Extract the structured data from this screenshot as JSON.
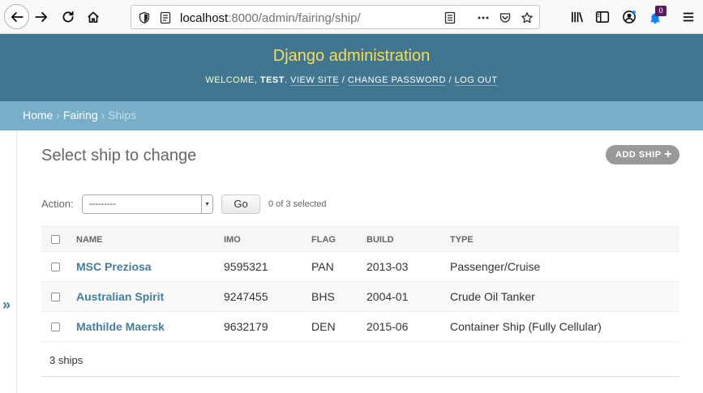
{
  "browser": {
    "url_host": "localhost",
    "url_rest": ":8000/admin/fairing/ship/",
    "notification_count": "0",
    "icons": [
      "back-icon",
      "forward-icon",
      "reload-icon",
      "home-icon",
      "shield-icon",
      "info-icon",
      "reader-icon",
      "more-icon",
      "pocket-icon",
      "bookmark-star-icon",
      "library-icon",
      "sidebar-icon",
      "account-icon",
      "extension-icon",
      "menu-icon"
    ]
  },
  "header": {
    "branding": "Django administration",
    "welcome": "Welcome, ",
    "username": "test",
    "view_site": "View site",
    "change_password": "Change password",
    "log_out": "Log out"
  },
  "breadcrumbs": {
    "home": "Home",
    "app": "Fairing",
    "current": "Ships"
  },
  "sidebar": {
    "toggle": "»"
  },
  "content": {
    "title": "Select ship to change",
    "add_button": "Add ship",
    "action_label": "Action:",
    "action_selected": "---------",
    "go_button": "Go",
    "selection_count": "0 of 3 selected",
    "columns": [
      "Name",
      "IMO",
      "Flag",
      "Build",
      "Type"
    ],
    "rows": [
      {
        "name": "MSC Preziosa",
        "imo": "9595321",
        "flag": "PAN",
        "build": "2013-03",
        "type": "Passenger/Cruise"
      },
      {
        "name": "Australian Spirit",
        "imo": "9247455",
        "flag": "BHS",
        "build": "2004-01",
        "type": "Crude Oil Tanker"
      },
      {
        "name": "Mathilde Maersk",
        "imo": "9632179",
        "flag": "DEN",
        "build": "2015-06",
        "type": "Container Ship (Fully Cellular)"
      }
    ],
    "result_count": "3 ships"
  },
  "colors": {
    "header_bg": "#417690",
    "branding": "#f5dd5d",
    "breadcrumbs_bg": "#79aec8",
    "link": "#447e9b",
    "add_button_bg": "#999999"
  }
}
